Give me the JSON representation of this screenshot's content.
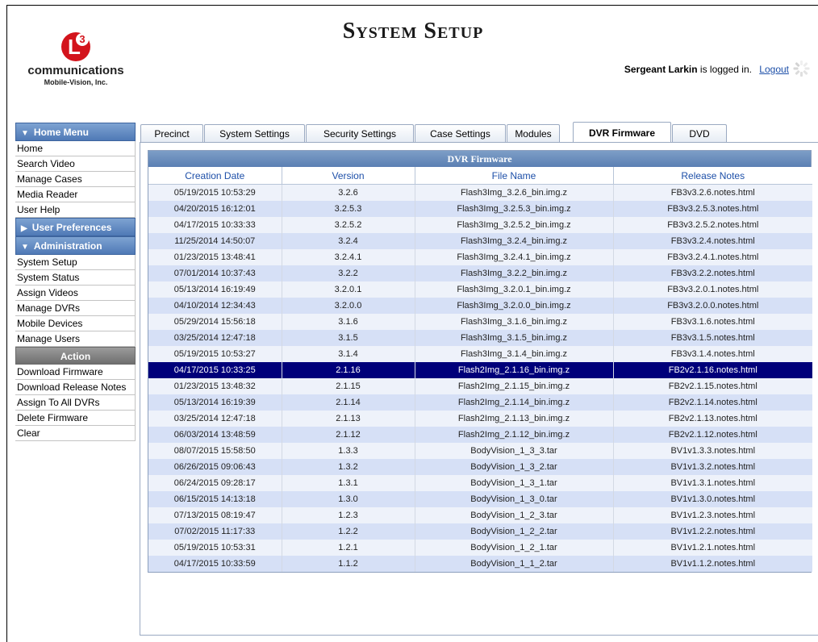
{
  "app": {
    "title": "System Setup",
    "logo_text": "communications",
    "logo_sub": "Mobile-Vision, Inc.",
    "logo_mark_letter": "L",
    "logo_mark_number": "3"
  },
  "login": {
    "user": "Sergeant Larkin",
    "suffix": "is logged in.",
    "logout_label": "Logout"
  },
  "sidebar": {
    "home_menu_title": "Home Menu",
    "home_items": [
      "Home",
      "Search Video",
      "Manage Cases",
      "Media Reader",
      "User Help"
    ],
    "user_prefs_title": "User Preferences",
    "admin_title": "Administration",
    "admin_items": [
      "System Setup",
      "System Status",
      "Assign Videos",
      "Manage DVRs",
      "Mobile Devices",
      "Manage Users"
    ],
    "action_title": "Action",
    "action_items": [
      "Download Firmware",
      "Download Release Notes",
      "Assign To All DVRs",
      "Delete Firmware",
      "Clear"
    ]
  },
  "tabs": [
    "Precinct",
    "System Settings",
    "Security Settings",
    "Case Settings",
    "Modules",
    "DVR Firmware",
    "DVD"
  ],
  "active_tab": "DVR Firmware",
  "table": {
    "title": "DVR Firmware",
    "columns": [
      "Creation Date",
      "Version",
      "File Name",
      "Release Notes"
    ],
    "selected_index": 11,
    "rows": [
      [
        "05/19/2015 10:53:29",
        "3.2.6",
        "Flash3Img_3.2.6_bin.img.z",
        "FB3v3.2.6.notes.html"
      ],
      [
        "04/20/2015 16:12:01",
        "3.2.5.3",
        "Flash3Img_3.2.5.3_bin.img.z",
        "FB3v3.2.5.3.notes.html"
      ],
      [
        "04/17/2015 10:33:33",
        "3.2.5.2",
        "Flash3Img_3.2.5.2_bin.img.z",
        "FB3v3.2.5.2.notes.html"
      ],
      [
        "11/25/2014 14:50:07",
        "3.2.4",
        "Flash3Img_3.2.4_bin.img.z",
        "FB3v3.2.4.notes.html"
      ],
      [
        "01/23/2015 13:48:41",
        "3.2.4.1",
        "Flash3Img_3.2.4.1_bin.img.z",
        "FB3v3.2.4.1.notes.html"
      ],
      [
        "07/01/2014 10:37:43",
        "3.2.2",
        "Flash3Img_3.2.2_bin.img.z",
        "FB3v3.2.2.notes.html"
      ],
      [
        "05/13/2014 16:19:49",
        "3.2.0.1",
        "Flash3Img_3.2.0.1_bin.img.z",
        "FB3v3.2.0.1.notes.html"
      ],
      [
        "04/10/2014 12:34:43",
        "3.2.0.0",
        "Flash3Img_3.2.0.0_bin.img.z",
        "FB3v3.2.0.0.notes.html"
      ],
      [
        "05/29/2014 15:56:18",
        "3.1.6",
        "Flash3Img_3.1.6_bin.img.z",
        "FB3v3.1.6.notes.html"
      ],
      [
        "03/25/2014 12:47:18",
        "3.1.5",
        "Flash3Img_3.1.5_bin.img.z",
        "FB3v3.1.5.notes.html"
      ],
      [
        "05/19/2015 10:53:27",
        "3.1.4",
        "Flash3Img_3.1.4_bin.img.z",
        "FB3v3.1.4.notes.html"
      ],
      [
        "04/17/2015 10:33:25",
        "2.1.16",
        "Flash2Img_2.1.16_bin.img.z",
        "FB2v2.1.16.notes.html"
      ],
      [
        "01/23/2015 13:48:32",
        "2.1.15",
        "Flash2Img_2.1.15_bin.img.z",
        "FB2v2.1.15.notes.html"
      ],
      [
        "05/13/2014 16:19:39",
        "2.1.14",
        "Flash2Img_2.1.14_bin.img.z",
        "FB2v2.1.14.notes.html"
      ],
      [
        "03/25/2014 12:47:18",
        "2.1.13",
        "Flash2Img_2.1.13_bin.img.z",
        "FB2v2.1.13.notes.html"
      ],
      [
        "06/03/2014 13:48:59",
        "2.1.12",
        "Flash2Img_2.1.12_bin.img.z",
        "FB2v2.1.12.notes.html"
      ],
      [
        "08/07/2015 15:58:50",
        "1.3.3",
        "BodyVision_1_3_3.tar",
        "BV1v1.3.3.notes.html"
      ],
      [
        "06/26/2015 09:06:43",
        "1.3.2",
        "BodyVision_1_3_2.tar",
        "BV1v1.3.2.notes.html"
      ],
      [
        "06/24/2015 09:28:17",
        "1.3.1",
        "BodyVision_1_3_1.tar",
        "BV1v1.3.1.notes.html"
      ],
      [
        "06/15/2015 14:13:18",
        "1.3.0",
        "BodyVision_1_3_0.tar",
        "BV1v1.3.0.notes.html"
      ],
      [
        "07/13/2015 08:19:47",
        "1.2.3",
        "BodyVision_1_2_3.tar",
        "BV1v1.2.3.notes.html"
      ],
      [
        "07/02/2015 11:17:33",
        "1.2.2",
        "BodyVision_1_2_2.tar",
        "BV1v1.2.2.notes.html"
      ],
      [
        "05/19/2015 10:53:31",
        "1.2.1",
        "BodyVision_1_2_1.tar",
        "BV1v1.2.1.notes.html"
      ],
      [
        "04/17/2015 10:33:59",
        "1.1.2",
        "BodyVision_1_1_2.tar",
        "BV1v1.1.2.notes.html"
      ]
    ]
  },
  "colors": {
    "header_blue": "#5b7fb3",
    "selected_row": "#00007a",
    "row_odd": "#eef2fa",
    "row_even": "#d6e0f6",
    "link": "#1d4fa8"
  }
}
